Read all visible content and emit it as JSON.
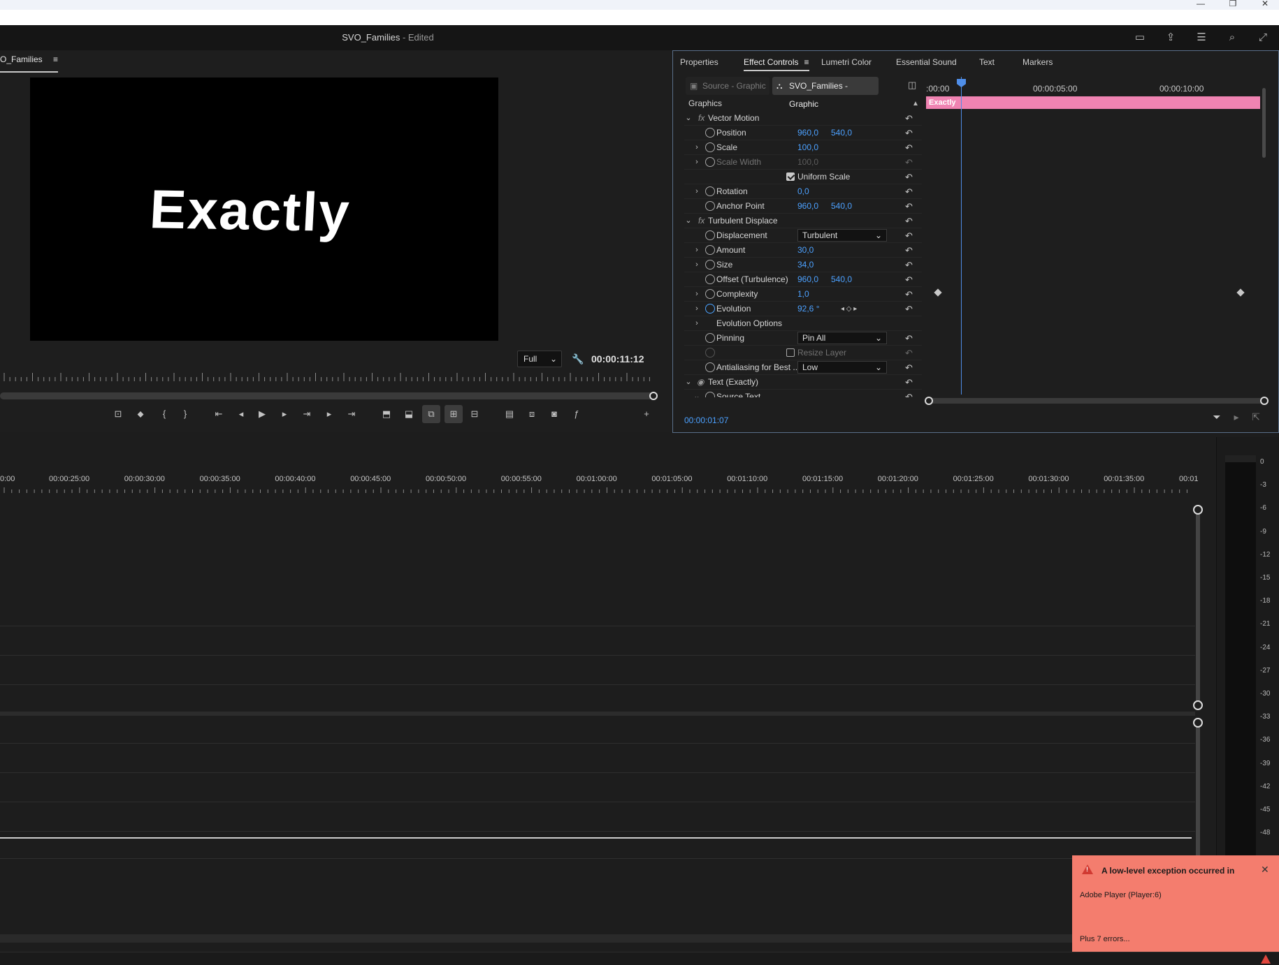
{
  "window": {
    "title": "SVO_Families",
    "title_suffix": " - Edited",
    "controls": {
      "minimize": "—",
      "restore": "❐",
      "close": "✕"
    }
  },
  "header_icons": [
    "workspaces-icon",
    "export-icon",
    "settings-icon",
    "search-icon",
    "fullscreen-icon"
  ],
  "program_monitor": {
    "tab_label": "O_Families",
    "video_text": "Exactly",
    "quality": "Full",
    "timecode": "00:00:11:12"
  },
  "transport_icons": [
    "add-marker-icon",
    "marker-icon",
    "mark-in-icon",
    "mark-out-icon",
    "go-to-in-icon",
    "step-back-icon",
    "play-icon",
    "step-forward-icon",
    "insert-icon",
    "go-to-out-icon",
    "lift-icon",
    "extract-icon",
    "loop-icon",
    "safe-margins-icon",
    "comparison-icon",
    "trim-icon",
    "proxy-icon",
    "camera-icon",
    "fx-icon",
    "add-button-icon"
  ],
  "effect_panel": {
    "tabs": [
      "Properties",
      "Effect Controls",
      "Lumetri Color",
      "Essential Sound",
      "Text",
      "Markers"
    ],
    "active_tab": "Effect Controls",
    "source_tab": "Source - Graphic",
    "sequence_tab": "SVO_Families - Graphic",
    "section_label": "Graphics",
    "ruler_labels": [
      ":00:00",
      "00:00:05:00",
      "00:00:10:00"
    ],
    "clip_name": "Exactly",
    "current_time": "00:00:01:07",
    "rows": [
      {
        "label": "Vector Motion",
        "kind": "fx",
        "tw": "open"
      },
      {
        "label": "Position",
        "v1": "960,0",
        "v2": "540,0"
      },
      {
        "label": "Scale",
        "v1": "100,0",
        "tw": "closed"
      },
      {
        "label": "Scale Width",
        "v1": "100,0",
        "tw": "closed",
        "disabled": true
      },
      {
        "label": "Uniform Scale",
        "kind": "checkbox",
        "checked": true
      },
      {
        "label": "Rotation",
        "v1": "0,0",
        "tw": "closed"
      },
      {
        "label": "Anchor Point",
        "v1": "960,0",
        "v2": "540,0"
      },
      {
        "label": "Turbulent Displace",
        "kind": "fx",
        "tw": "open"
      },
      {
        "label": "Displacement",
        "kind": "dropdown",
        "value": "Turbulent"
      },
      {
        "label": "Amount",
        "v1": "30,0",
        "tw": "closed"
      },
      {
        "label": "Size",
        "v1": "34,0",
        "tw": "closed"
      },
      {
        "label": "Offset (Turbulence)",
        "v1": "960,0",
        "v2": "540,0"
      },
      {
        "label": "Complexity",
        "v1": "1,0",
        "tw": "closed"
      },
      {
        "label": "Evolution",
        "v1": "92,6 °",
        "tw": "closed",
        "animated": true
      },
      {
        "label": "Evolution Options",
        "kind": "group",
        "tw": "closed"
      },
      {
        "label": "Pinning",
        "kind": "dropdown",
        "value": "Pin All"
      },
      {
        "label": "Resize Layer",
        "kind": "checkbox",
        "checked": false,
        "disabled": true
      },
      {
        "label": "Antialiasing for Best ...",
        "kind": "dropdown",
        "value": "Low"
      },
      {
        "label": "Text (Exactly)",
        "kind": "text-layer",
        "tw": "open"
      },
      {
        "label": "Source Text",
        "tw": "open",
        "indent": true
      }
    ]
  },
  "timeline": {
    "labels": [
      "0:00",
      "00:00:25:00",
      "00:00:30:00",
      "00:00:35:00",
      "00:00:40:00",
      "00:00:45:00",
      "00:00:50:00",
      "00:00:55:00",
      "00:01:00:00",
      "00:01:05:00",
      "00:01:10:00",
      "00:01:15:00",
      "00:01:20:00",
      "00:01:25:00",
      "00:01:30:00",
      "00:01:35:00",
      "00:01"
    ]
  },
  "audio_meter": {
    "labels": [
      "0",
      "-3",
      "-6",
      "-9",
      "-12",
      "-15",
      "-18",
      "-21",
      "-24",
      "-27",
      "-30",
      "-33",
      "-36",
      "-39",
      "-42",
      "-45",
      "-48"
    ]
  },
  "error_toast": {
    "title": "A low-level exception occurred in",
    "message": "Adobe Player (Player:6)",
    "more": "Plus 7 errors..."
  },
  "colors": {
    "accent": "#4ca1ff",
    "clip": "#f083b2",
    "toast": "#f47d6e",
    "error": "#e0463d"
  }
}
